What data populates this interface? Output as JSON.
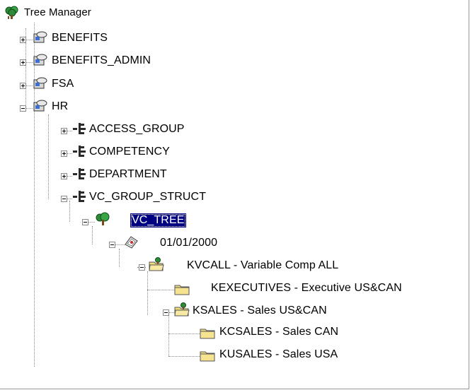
{
  "tree": {
    "root_label": "Tree Manager",
    "nodes": [
      {
        "label": "BENEFITS",
        "level": 1,
        "expander": "plus",
        "icon": "database-icon"
      },
      {
        "label": "BENEFITS_ADMIN",
        "level": 1,
        "expander": "plus",
        "icon": "database-icon"
      },
      {
        "label": "FSA",
        "level": 1,
        "expander": "plus",
        "icon": "database-icon"
      },
      {
        "label": "HR",
        "level": 1,
        "expander": "minus",
        "icon": "database-icon"
      },
      {
        "label": "ACCESS_GROUP",
        "level": 2,
        "expander": "plus",
        "icon": "tree-structure-icon"
      },
      {
        "label": "COMPETENCY",
        "level": 2,
        "expander": "plus",
        "icon": "tree-structure-icon"
      },
      {
        "label": "DEPARTMENT",
        "level": 2,
        "expander": "plus",
        "icon": "tree-structure-icon"
      },
      {
        "label": "VC_GROUP_STRUCT",
        "level": 2,
        "expander": "minus",
        "icon": "tree-structure-icon"
      },
      {
        "label": "VC_TREE",
        "level": 3,
        "expander": "minus",
        "icon": "green-tree-icon",
        "selected": true
      },
      {
        "label": "01/01/2000",
        "level": 4,
        "expander": "minus",
        "icon": "effective-date-icon"
      },
      {
        "label": "KVCALL - Variable Comp ALL",
        "level": 5,
        "expander": "minus",
        "icon": "open-folder-tree-icon"
      },
      {
        "label": "KEXECUTIVES - Executive US&CAN",
        "level": 6,
        "expander": "none",
        "icon": "folder-icon"
      },
      {
        "label": "KSALES - Sales US&CAN",
        "level": 6,
        "expander": "minus",
        "icon": "open-folder-tree-icon"
      },
      {
        "label": "KCSALES - Sales CAN",
        "level": 7,
        "expander": "none",
        "icon": "folder-icon"
      },
      {
        "label": "KUSALES - Sales USA",
        "level": 7,
        "expander": "none",
        "icon": "folder-icon"
      }
    ]
  },
  "colors": {
    "selection": "#000080",
    "folder": "#f2dd7c",
    "tree_green": "#2e8b3a"
  }
}
